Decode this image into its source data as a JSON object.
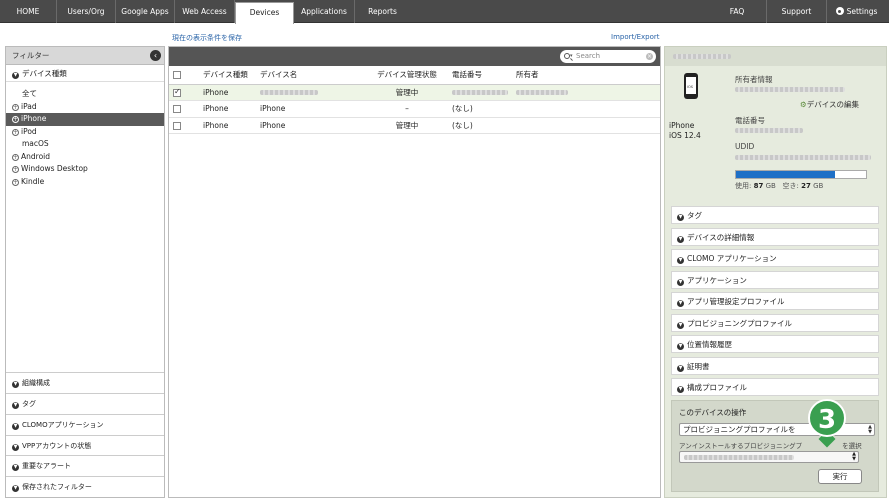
{
  "nav": {
    "tabs": [
      "HOME",
      "Users/Org",
      "Google Apps",
      "Web Access",
      "Devices",
      "Applications",
      "Reports"
    ],
    "active_tab": "Devices",
    "faq": "FAQ",
    "support": "Support",
    "settings": "Settings"
  },
  "links": {
    "save_view": "現在の表示条件を保存",
    "import_export": "Import/Export"
  },
  "filter": {
    "title": "フィルター",
    "device_type_header": "デバイス種類",
    "items": [
      "全て",
      "iPad",
      "iPhone",
      "iPod",
      "macOS",
      "Android",
      "Windows Desktop",
      "Kindle"
    ],
    "selected": "iPhone",
    "bottom_sections": [
      "組織構成",
      "タグ",
      "CLOMOアプリケーション",
      "VPPアカウントの状態",
      "重要なアラート",
      "保存されたフィルター"
    ]
  },
  "list": {
    "search_placeholder": "Search",
    "columns": [
      "デバイス種類",
      "デバイス名",
      "デバイス管理状態",
      "電話番号",
      "所有者"
    ],
    "rows": [
      {
        "type": "iPhone",
        "name": "",
        "status": "管理中",
        "phone": "",
        "owner": "",
        "checked": true
      },
      {
        "type": "iPhone",
        "name": "iPhone",
        "status": "–",
        "phone": "(なし)",
        "owner": "",
        "checked": false
      },
      {
        "type": "iPhone",
        "name": "iPhone",
        "status": "管理中",
        "phone": "(なし)",
        "owner": "",
        "checked": false
      }
    ]
  },
  "details": {
    "phone_icon_text": "iOS",
    "model": "iPhone",
    "os": "iOS 12.4",
    "owner_label": "所有者情報",
    "edit_device": "デバイスの編集",
    "phone_label": "電話番号",
    "udid_label": "UDID",
    "storage": {
      "used_label": "使用:",
      "used": "87",
      "free_label": "空き:",
      "free": "27",
      "unit": "GB",
      "used_fraction": 0.76
    },
    "accordions": [
      "タグ",
      "デバイスの詳細情報",
      "CLOMO アプリケーション",
      "アプリケーション",
      "アプリ管理設定プロファイル",
      "プロビジョニングプロファイル",
      "位置情報履歴",
      "証明書",
      "構成プロファイル"
    ],
    "operation": {
      "title": "このデバイスの操作",
      "selected_action": "プロビジョニングプロファイルを",
      "sub_label": "アンインストールするプロビジョニングプ",
      "sub_label_end": "を選択",
      "run_button": "実行"
    }
  },
  "step_badge": "3",
  "colors": {
    "nav_bg": "#4a4a4a",
    "selection": "#5a5a5a",
    "storage_bar": "#1e6fc6",
    "step_badge": "#3a9f50",
    "details_bg": "#e6ebde"
  }
}
